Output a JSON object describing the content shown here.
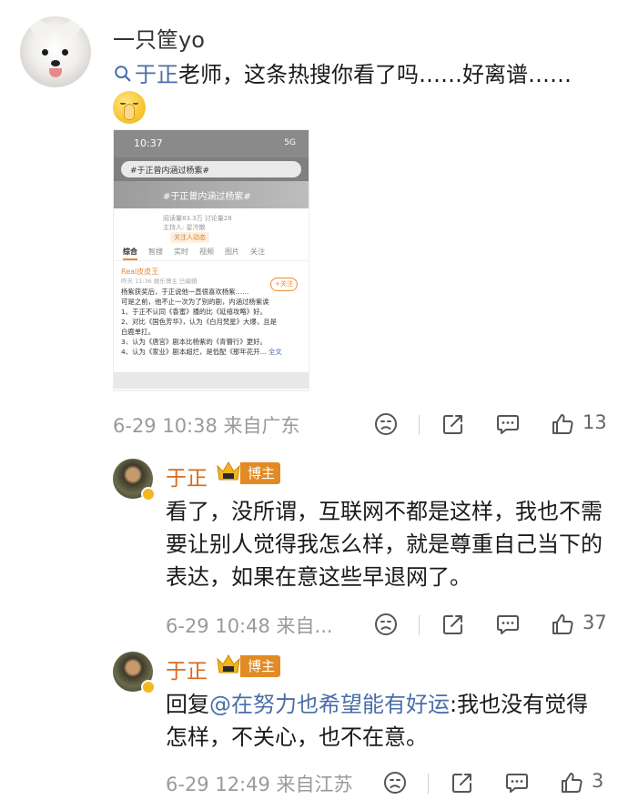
{
  "post": {
    "username": "一只筐yo",
    "topic": "于正",
    "text": "老师，这条热搜你看了吗……好离谱……",
    "embedded_screenshot": {
      "status_time": "10:37",
      "status_right": "5G",
      "search_query": "#于正曾内涵过杨紫#",
      "banner_title": "#于正曾内涵过杨紫#",
      "read_stats": "阅读量83.3万  讨论量28",
      "host": "主持人: 星冷散",
      "follow_tag": "关注人动态",
      "tabs": [
        "综合",
        "智搜",
        "实时",
        "视频",
        "图片",
        "关注"
      ],
      "card_user": "Real皮皮王",
      "card_time": "昨天 11:36 娱乐博主 已编辑",
      "follow_btn": "+关注",
      "card_lines": [
        "杨紫获奖后，于正说他一直很喜欢杨紫……",
        "可是之前，他不止一次为了别的剧，内涵过杨紫诶",
        "1、于正不认同《香蜜》播的比《延禧攻略》好。",
        "2、对比《国色芳华》，认为《白月梵星》大爆，且是",
        "白鹿单扛。",
        "3、认为《唐宫》剧本比杨紫的《青簪行》更好。",
        "4、认为《家业》剧本超烂，是低配《那年花开..."
      ],
      "full_text_link": "全文"
    },
    "time": "6-29 10:38",
    "location": "来自广东",
    "like_count": "13"
  },
  "replies": [
    {
      "name": "于正",
      "badge": "博主",
      "text": "看了，没所谓，互联网不都是这样，我也不需要让别人觉得我怎么样，就是尊重自己当下的表达，如果在意这些早退网了。",
      "time": "6-29 10:48",
      "location": "来自...",
      "like_count": "37"
    },
    {
      "name": "于正",
      "badge": "博主",
      "reply_prefix": "回复",
      "mention": "@在努力也希望能有好运",
      "text": ":我也没有觉得怎样，不关心，也不在意。",
      "time": "6-29 12:49",
      "location": "来自江苏",
      "like_count": "3"
    }
  ],
  "icons": {
    "dislike": "frown-face-icon",
    "share": "share-icon",
    "comment": "comment-bubble-icon",
    "like": "thumbs-up-icon"
  },
  "colors": {
    "accent_orange": "#d86a1e",
    "link_blue": "#4b6ea9",
    "badge_orange": "#e28a23"
  }
}
